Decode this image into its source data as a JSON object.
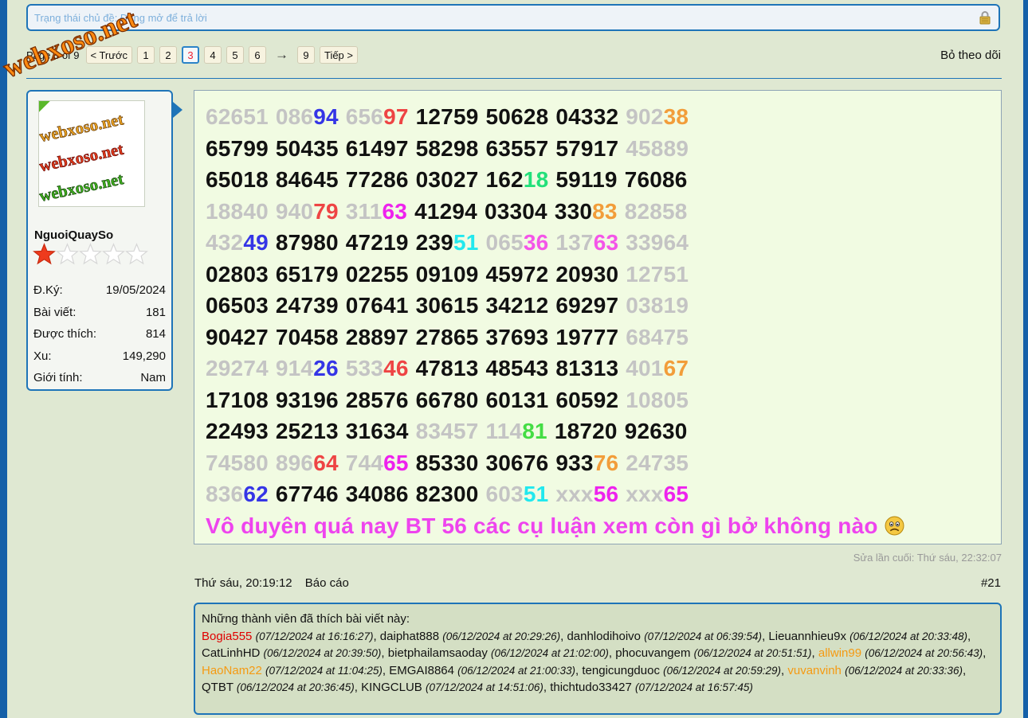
{
  "status": {
    "placeholder": "Trạng thái chủ đề: Đang mở để trả lời"
  },
  "watermark": {
    "text": "webxoso.net"
  },
  "pagination": {
    "label": "Page 3 of 9",
    "prev": "< Trước",
    "pages": [
      "1",
      "2",
      "3",
      "4",
      "5",
      "6"
    ],
    "current": "3",
    "arrow": "→",
    "last": "9",
    "next": "Tiếp >"
  },
  "unfollow": "Bỏ theo dõi",
  "user": {
    "avatar_text": "webxoso.net",
    "name": "NguoiQuaySo",
    "rating": 1,
    "rating_max": 5,
    "stats": [
      {
        "label": "Đ.Ký:",
        "value": "19/05/2024"
      },
      {
        "label": "Bài viết:",
        "value": "181"
      },
      {
        "label": "Được thích:",
        "value": "814"
      },
      {
        "label": "Xu:",
        "value": "149,290"
      },
      {
        "label": "Giới tính:",
        "value": "Nam"
      }
    ]
  },
  "colors": {
    "black": "#111111",
    "gray": "#c4c4c4",
    "blue": "#3535e6",
    "red": "#ee4444",
    "orange": "#f29d3a",
    "green": "#22e07a",
    "magenta": "#ee22ee",
    "pink": "#f455e8",
    "cyan": "#22e8ee",
    "lime": "#44dd44"
  },
  "post": {
    "lines": [
      [
        [
          [
            "62651",
            "gray"
          ]
        ],
        [
          [
            "086",
            "gray"
          ],
          [
            "94",
            "blue"
          ]
        ],
        [
          [
            "656",
            "gray"
          ],
          [
            "97",
            "red"
          ]
        ],
        [
          [
            "12759",
            "black"
          ]
        ],
        [
          [
            "50628",
            "black"
          ]
        ],
        [
          [
            "04332",
            "black"
          ]
        ],
        [
          [
            "902",
            "gray"
          ],
          [
            "38",
            "orange"
          ]
        ]
      ],
      [
        [
          [
            "65799",
            "black"
          ]
        ],
        [
          [
            "50435",
            "black"
          ]
        ],
        [
          [
            "61497",
            "black"
          ]
        ],
        [
          [
            "58298",
            "black"
          ]
        ],
        [
          [
            "63557",
            "black"
          ]
        ],
        [
          [
            "57917",
            "black"
          ]
        ],
        [
          [
            "45889",
            "gray"
          ]
        ]
      ],
      [
        [
          [
            "65018",
            "black"
          ]
        ],
        [
          [
            "84645",
            "black"
          ]
        ],
        [
          [
            "77286",
            "black"
          ]
        ],
        [
          [
            "03027",
            "black"
          ]
        ],
        [
          [
            "162",
            "black"
          ],
          [
            "18",
            "green"
          ]
        ],
        [
          [
            "59119",
            "black"
          ]
        ],
        [
          [
            "76086",
            "black"
          ]
        ]
      ],
      [
        [
          [
            "18840",
            "gray"
          ]
        ],
        [
          [
            "940",
            "gray"
          ],
          [
            "79",
            "red"
          ]
        ],
        [
          [
            "311",
            "gray"
          ],
          [
            "63",
            "magenta"
          ]
        ],
        [
          [
            "41294",
            "black"
          ]
        ],
        [
          [
            "03304",
            "black"
          ]
        ],
        [
          [
            "330",
            "black"
          ],
          [
            "83",
            "orange"
          ]
        ],
        [
          [
            "82858",
            "gray"
          ]
        ]
      ],
      [
        [
          [
            "432",
            "gray"
          ],
          [
            "49",
            "blue"
          ]
        ],
        [
          [
            "87980",
            "black"
          ]
        ],
        [
          [
            "47219",
            "black"
          ]
        ],
        [
          [
            "239",
            "black"
          ],
          [
            "51",
            "cyan"
          ]
        ],
        [
          [
            "065",
            "gray"
          ],
          [
            "36",
            "pink"
          ]
        ],
        [
          [
            "137",
            "gray"
          ],
          [
            "63",
            "pink"
          ]
        ],
        [
          [
            "33964",
            "gray"
          ]
        ]
      ],
      [
        [
          [
            "02803",
            "black"
          ]
        ],
        [
          [
            "65179",
            "black"
          ]
        ],
        [
          [
            "02255",
            "black"
          ]
        ],
        [
          [
            "09109",
            "black"
          ]
        ],
        [
          [
            "45972",
            "black"
          ]
        ],
        [
          [
            "20930",
            "black"
          ]
        ],
        [
          [
            "12751",
            "gray"
          ]
        ]
      ],
      [
        [
          [
            "06503",
            "black"
          ]
        ],
        [
          [
            "24739",
            "black"
          ]
        ],
        [
          [
            "07641",
            "black"
          ]
        ],
        [
          [
            "30615",
            "black"
          ]
        ],
        [
          [
            "34212",
            "black"
          ]
        ],
        [
          [
            "69297",
            "black"
          ]
        ],
        [
          [
            "03819",
            "gray"
          ]
        ]
      ],
      [
        [
          [
            "90427",
            "black"
          ]
        ],
        [
          [
            "70458",
            "black"
          ]
        ],
        [
          [
            "28897",
            "black"
          ]
        ],
        [
          [
            "27865",
            "black"
          ]
        ],
        [
          [
            "37693",
            "black"
          ]
        ],
        [
          [
            "19777",
            "black"
          ]
        ],
        [
          [
            "68475",
            "gray"
          ]
        ]
      ],
      [
        [
          [
            "29274",
            "gray"
          ]
        ],
        [
          [
            "914",
            "gray"
          ],
          [
            "26",
            "blue"
          ]
        ],
        [
          [
            "533",
            "gray"
          ],
          [
            "46",
            "red"
          ]
        ],
        [
          [
            "47813",
            "black"
          ]
        ],
        [
          [
            "48543",
            "black"
          ]
        ],
        [
          [
            "81313",
            "black"
          ]
        ],
        [
          [
            "401",
            "gray"
          ],
          [
            "67",
            "orange"
          ]
        ]
      ],
      [
        [
          [
            "17108",
            "black"
          ]
        ],
        [
          [
            "93196",
            "black"
          ]
        ],
        [
          [
            "28576",
            "black"
          ]
        ],
        [
          [
            "66780",
            "black"
          ]
        ],
        [
          [
            "60131",
            "black"
          ]
        ],
        [
          [
            "60592",
            "black"
          ]
        ],
        [
          [
            "10805",
            "gray"
          ]
        ]
      ],
      [
        [
          [
            "22493",
            "black"
          ]
        ],
        [
          [
            "25213",
            "black"
          ]
        ],
        [
          [
            "31634",
            "black"
          ]
        ],
        [
          [
            "83457",
            "gray"
          ]
        ],
        [
          [
            "114",
            "gray"
          ],
          [
            "81",
            "lime"
          ]
        ],
        [
          [
            "18720",
            "black"
          ]
        ],
        [
          [
            "92630",
            "black"
          ]
        ]
      ],
      [
        [
          [
            "74580",
            "gray"
          ]
        ],
        [
          [
            "896",
            "gray"
          ],
          [
            "64",
            "red"
          ]
        ],
        [
          [
            "744",
            "gray"
          ],
          [
            "65",
            "magenta"
          ]
        ],
        [
          [
            "85330",
            "black"
          ]
        ],
        [
          [
            "30676",
            "black"
          ]
        ],
        [
          [
            "933",
            "black"
          ],
          [
            "76",
            "orange"
          ]
        ],
        [
          [
            "24735",
            "gray"
          ]
        ]
      ],
      [
        [
          [
            "836",
            "gray"
          ],
          [
            "62",
            "blue"
          ]
        ],
        [
          [
            "67746",
            "black"
          ]
        ],
        [
          [
            "34086",
            "black"
          ]
        ],
        [
          [
            "82300",
            "black"
          ]
        ],
        [
          [
            "603",
            "gray"
          ],
          [
            "51",
            "cyan"
          ]
        ],
        [
          [
            "xxx",
            "gray"
          ],
          [
            "56",
            "magenta"
          ]
        ],
        [
          [
            "xxx",
            "gray"
          ],
          [
            "65",
            "magenta"
          ]
        ]
      ]
    ],
    "closing": "Vô duyên quá nay BT 56 các cụ luận xem còn gì bở không nào",
    "emoji": "sad-face"
  },
  "edited": "Sửa lần cuối: Thứ sáu, 22:32:07",
  "meta": {
    "time": "Thứ sáu, 20:19:12",
    "report": "Báo cáo",
    "number": "#21"
  },
  "likes": {
    "title": "Những thành viên đã thích bài viết này:",
    "entries": [
      {
        "name": "Bogia555",
        "time": "(07/12/2024 at 16:16:27)",
        "color": "#e00000"
      },
      {
        "name": "daiphat888",
        "time": "(06/12/2024 at 20:29:26)",
        "color": "#111111"
      },
      {
        "name": "danhlodihoivo",
        "time": "(07/12/2024 at 06:39:54)",
        "color": "#111111"
      },
      {
        "name": "Lieuannhieu9x",
        "time": "(06/12/2024 at 20:33:48)",
        "color": "#111111"
      },
      {
        "name": "CatLinhHD",
        "time": "(06/12/2024 at 20:39:50)",
        "color": "#111111"
      },
      {
        "name": "bietphailamsaoday",
        "time": "(06/12/2024 at 21:02:00)",
        "color": "#111111"
      },
      {
        "name": "phocuvangem",
        "time": "(06/12/2024 at 20:51:51)",
        "color": "#111111"
      },
      {
        "name": "allwin99",
        "time": "(06/12/2024 at 20:56:43)",
        "color": "#f59a12"
      },
      {
        "name": "HaoNam22",
        "time": "(07/12/2024 at 11:04:25)",
        "color": "#f59a12"
      },
      {
        "name": "EMGAI8864",
        "time": "(06/12/2024 at 21:00:33)",
        "color": "#111111"
      },
      {
        "name": "tengicungduoc",
        "time": "(06/12/2024 at 20:59:29)",
        "color": "#111111"
      },
      {
        "name": "vuvanvinh",
        "time": "(06/12/2024 at 20:33:36)",
        "color": "#f59a12"
      },
      {
        "name": "QTBT",
        "time": "(06/12/2024 at 20:36:45)",
        "color": "#111111"
      },
      {
        "name": "KINGCLUB",
        "time": "(07/12/2024 at 14:51:06)",
        "color": "#111111"
      },
      {
        "name": "thichtudo33427",
        "time": "(07/12/2024 at 16:57:45)",
        "color": "#111111"
      }
    ]
  }
}
